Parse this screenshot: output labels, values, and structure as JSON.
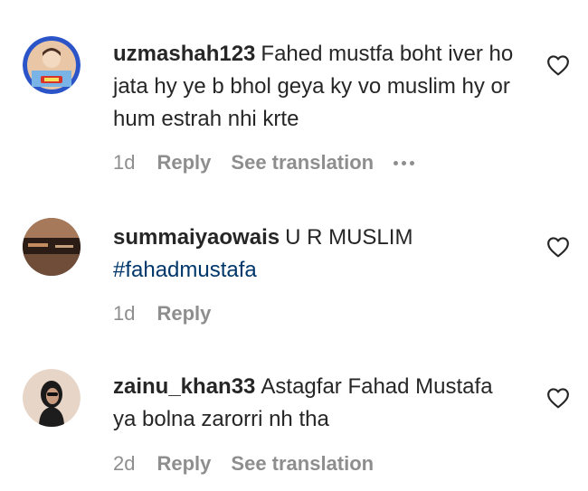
{
  "comments": [
    {
      "username": "uzmashah123",
      "text": "Fahed mustfa boht iver ho jata hy ye b bhol geya ky vo muslim hy or hum estrah nhi krte",
      "age": "1d",
      "reply_label": "Reply",
      "translate_label": "See translation",
      "avatar_icon": "profile-photo-icon",
      "like_icon": "heart-outline-icon"
    },
    {
      "username": "summaiyaowais",
      "text": "U R MUSLIM",
      "hashtag": "#fahadmustafa",
      "age": "1d",
      "reply_label": "Reply",
      "avatar_icon": "profile-photo-icon",
      "like_icon": "heart-outline-icon"
    },
    {
      "username": "zainu_khan33",
      "text": "Astagfar Fahad Mustafa ya bolna zarorri nh tha",
      "age": "2d",
      "reply_label": "Reply",
      "translate_label": "See translation",
      "avatar_icon": "profile-photo-icon",
      "like_icon": "heart-outline-icon"
    }
  ],
  "colors": {
    "text": "#262626",
    "secondary": "#8e8e8e",
    "hashtag": "#00376b"
  }
}
